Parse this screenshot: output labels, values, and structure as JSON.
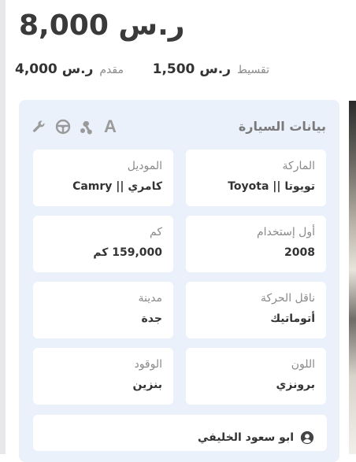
{
  "price": {
    "main": "8,000 ر.س"
  },
  "installment": {
    "label": "تقسيط",
    "value": "1,500 ر.س"
  },
  "down_payment": {
    "label": "مقدم",
    "value": "4,000 ر.س"
  },
  "card": {
    "title": "بيانات السيارة",
    "icons": [
      "wrench-icon",
      "steering-wheel-icon",
      "engine-icon",
      "automatic-transmission-icon"
    ],
    "fields": [
      {
        "label": "الماركة",
        "value": "تويوتا || Toyota"
      },
      {
        "label": "الموديل",
        "value": "كامري || Camry"
      },
      {
        "label": "أول إستخدام",
        "value": "2008"
      },
      {
        "label": "كم",
        "value": "159,000 كم"
      },
      {
        "label": "ناقل الحركة",
        "value": "أتوماتيك"
      },
      {
        "label": "مدينة",
        "value": "جدة"
      },
      {
        "label": "اللون",
        "value": "برونزي"
      },
      {
        "label": "الوقود",
        "value": "بنزين"
      }
    ],
    "owner": {
      "name": "ابو سعود الخليفي",
      "icon": "user-circle-icon"
    }
  },
  "colors": {
    "card_bg": "#ebf1fa",
    "field_bg": "#ffffff",
    "muted": "#8a8a8a"
  }
}
